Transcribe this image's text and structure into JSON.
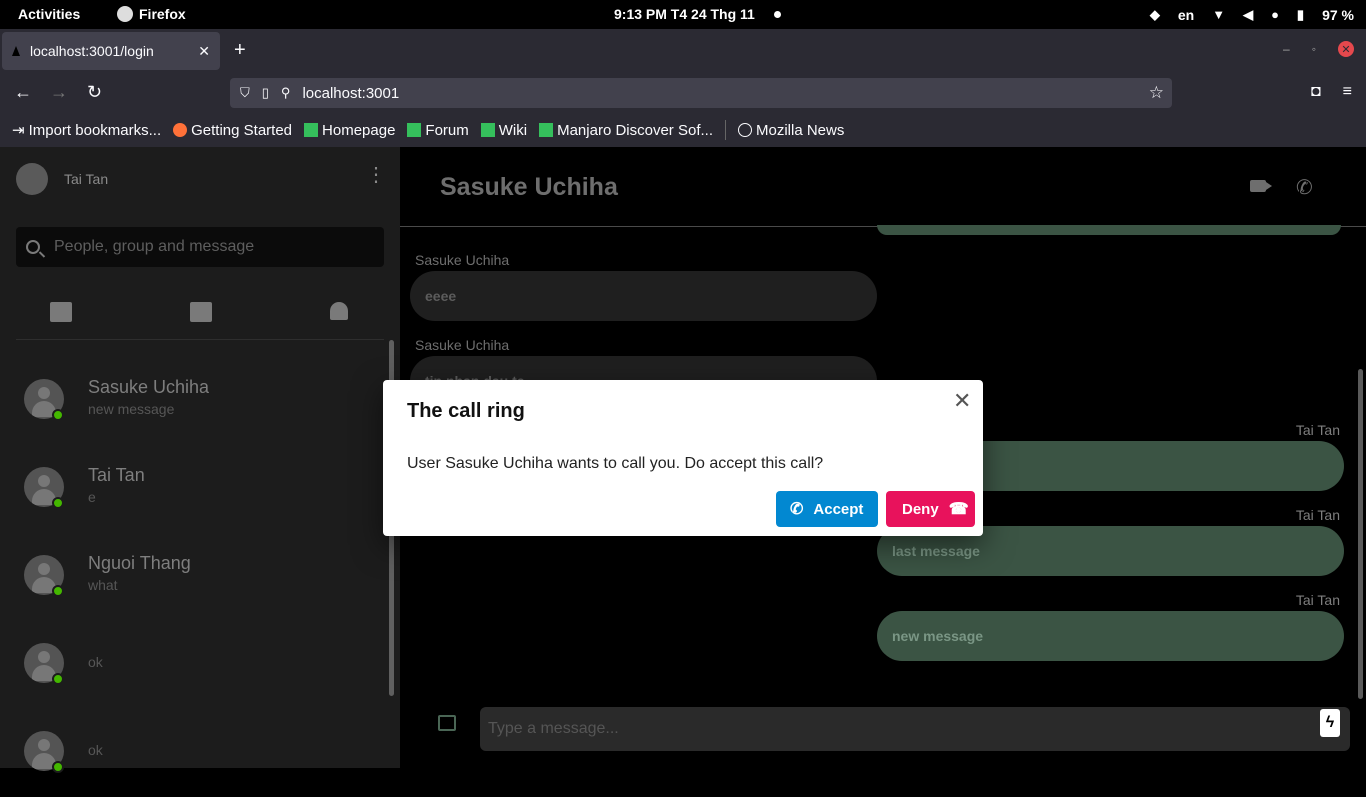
{
  "system": {
    "activities": "Activities",
    "app_name": "Firefox",
    "clock": "9:13 PM  T4 24 Thg 11",
    "lang": "en",
    "battery": "97 %"
  },
  "browser": {
    "tab_title": "localhost:3001/login",
    "url": "localhost:3001",
    "bookmarks": [
      {
        "label": "Import bookmarks...",
        "icon": "import-icon"
      },
      {
        "label": "Getting Started",
        "icon": "firefox-icon"
      },
      {
        "label": "Homepage",
        "icon": "manjaro-icon"
      },
      {
        "label": "Forum",
        "icon": "manjaro-icon"
      },
      {
        "label": "Wiki",
        "icon": "manjaro-icon"
      },
      {
        "label": "Manjaro Discover Sof...",
        "icon": "manjaro-icon"
      },
      {
        "label": "Mozilla News",
        "icon": "globe-icon"
      }
    ]
  },
  "sidebar": {
    "user_name": "Tai Tan",
    "search_placeholder": "People, group and message",
    "conversations": [
      {
        "name": "Sasuke Uchiha",
        "last": "new message",
        "online": true
      },
      {
        "name": "Tai Tan",
        "last": "e",
        "online": true
      },
      {
        "name": "Nguoi Thang",
        "last": "what",
        "online": true
      },
      {
        "name": "",
        "last": "ok",
        "online": true
      },
      {
        "name": "",
        "last": "ok",
        "online": true
      }
    ]
  },
  "chat": {
    "title": "Sasuke Uchiha",
    "messages": [
      {
        "sender": "Sasuke Uchiha",
        "text": "eeee",
        "mine": false
      },
      {
        "sender": "Sasuke Uchiha",
        "text": "tin nhan dau te",
        "mine": false
      },
      {
        "sender": "Tai Tan",
        "text": "",
        "mine": true
      },
      {
        "sender": "Tai Tan",
        "text": "last message",
        "mine": true
      },
      {
        "sender": "Tai Tan",
        "text": "new message",
        "mine": true
      }
    ],
    "composer_placeholder": "Type a message..."
  },
  "dialog": {
    "title": "The call ring",
    "text": "User Sasuke Uchiha wants to call you. Do accept this call?",
    "accept_label": "Accept",
    "deny_label": "Deny"
  },
  "colors": {
    "accept": "#0288d1",
    "deny": "#e8125c",
    "my_bubble": "#3b5444",
    "online": "#44b700"
  }
}
